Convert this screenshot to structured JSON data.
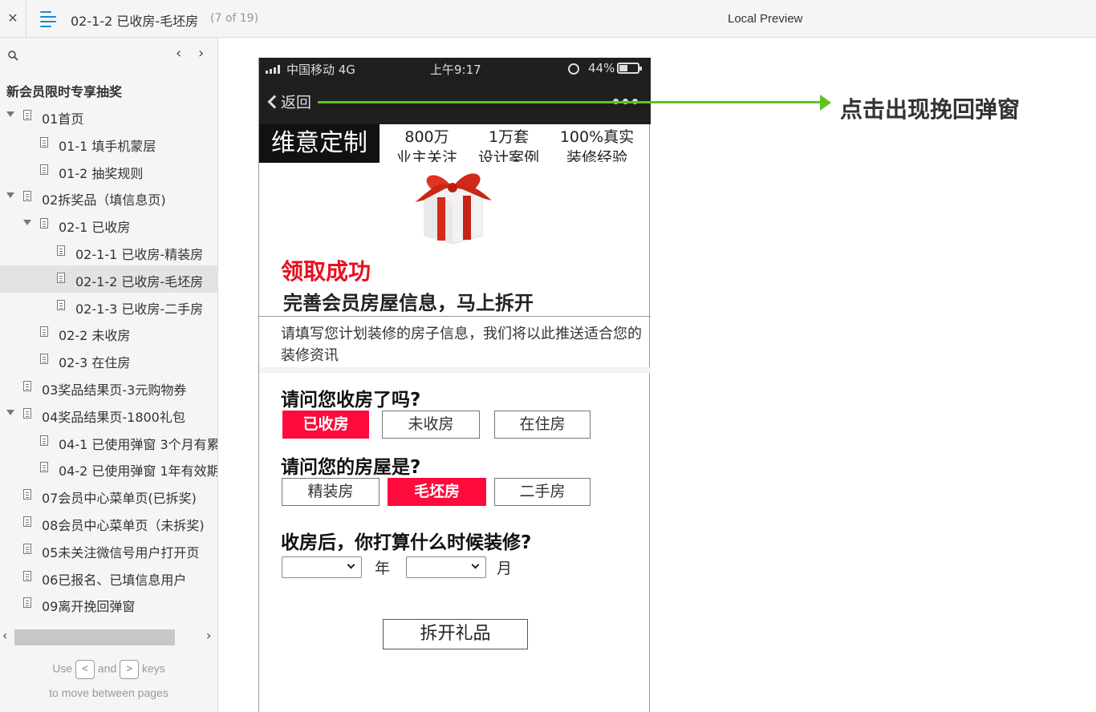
{
  "topbar": {
    "close_label": "✕",
    "menu_icon": "hamburger-icon",
    "page_title": "02-1-2 已收房-毛坯房",
    "page_count": "(7 of 19)",
    "preview_label": "Local Preview"
  },
  "sidebar": {
    "search_icon": "search-icon",
    "prev_label": "‹",
    "next_label": "›",
    "root_label": "新会员限时专享抽奖",
    "items": [
      {
        "label": "01首页",
        "level": 0,
        "toggle": true
      },
      {
        "label": "01-1 填手机蒙层",
        "level": 1,
        "toggle": false
      },
      {
        "label": "01-2 抽奖规则",
        "level": 1,
        "toggle": false
      },
      {
        "label": "02拆奖品（填信息页)",
        "level": 0,
        "toggle": true
      },
      {
        "label": "02-1 已收房",
        "level": 1,
        "toggle": true
      },
      {
        "label": "02-1-1 已收房-精装房",
        "level": 2,
        "toggle": false
      },
      {
        "label": "02-1-2 已收房-毛坯房",
        "level": 2,
        "toggle": false,
        "selected": true
      },
      {
        "label": "02-1-3 已收房-二手房",
        "level": 2,
        "toggle": false
      },
      {
        "label": "02-2 未收房",
        "level": 1,
        "toggle": false
      },
      {
        "label": "02-3 在住房",
        "level": 1,
        "toggle": false
      },
      {
        "label": "03奖品结果页-3元购物券",
        "level": 0,
        "toggle": false
      },
      {
        "label": "04奖品结果页-1800礼包",
        "level": 0,
        "toggle": true
      },
      {
        "label": "04-1 已使用弹窗 3个月有累",
        "level": 1,
        "toggle": false
      },
      {
        "label": "04-2 已使用弹窗 1年有效期",
        "level": 1,
        "toggle": false
      },
      {
        "label": "07会员中心菜单页(已拆奖)",
        "level": 0,
        "toggle": false
      },
      {
        "label": "08会员中心菜单页（未拆奖)",
        "level": 0,
        "toggle": false
      },
      {
        "label": "05未关注微信号用户打开页",
        "level": 0,
        "toggle": false
      },
      {
        "label": "06已报名、已填信息用户",
        "level": 0,
        "toggle": false
      },
      {
        "label": "09离开挽回弹窗",
        "level": 0,
        "toggle": false
      }
    ],
    "scroll_left": "‹",
    "scroll_right": "›",
    "help_use": "Use",
    "help_key_prev": "<",
    "help_and": "and",
    "help_key_next": ">",
    "help_keys": "keys",
    "help_line2": "to move between pages"
  },
  "phone": {
    "carrier": "中国移动   4G",
    "clock": "上午9:17",
    "battery_pct": "44%",
    "battery_level": 0.44,
    "back_label": "返回",
    "brand": "维意定制",
    "stats": [
      {
        "line1": "800万",
        "line2": "业主关注"
      },
      {
        "line1": "1万套",
        "line2": "设计案例"
      },
      {
        "line1": "100%真实",
        "line2": "装修经验"
      }
    ],
    "success_title": "领取成功",
    "subhead": "完善会员房屋信息，马上拆开",
    "intro": "请填写您计划装修的房子信息，我们将以此推送适合您的装修资讯",
    "q1": "请问您收房了吗?",
    "q1_options": [
      "已收房",
      "未收房",
      "在住房"
    ],
    "q2": "请问您的房屋是?",
    "q2_options": [
      "精装房",
      "毛坯房",
      "二手房"
    ],
    "q3": "收房后，你打算什么时候装修?",
    "year_unit": "年",
    "month_unit": "月",
    "cta": "拆开礼品"
  },
  "annotation": {
    "text": "点击出现挽回弹窗",
    "color": "#5ec21e"
  },
  "colors": {
    "accent_red": "#ff0a3c",
    "success_red": "#e8101e",
    "status_bar": "#1f1f1f"
  }
}
